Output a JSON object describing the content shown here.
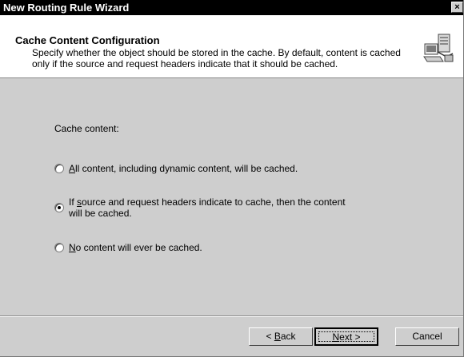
{
  "window": {
    "title": "New Routing Rule Wizard",
    "close_glyph": "×"
  },
  "header": {
    "title": "Cache Content Configuration",
    "description": "Specify whether the object should be stored in the cache. By default, content is cached only if the source and request headers indicate that it should be cached.",
    "icon": "wizard-computer-icon"
  },
  "content": {
    "prompt": "Cache content:",
    "options": [
      {
        "mnemonic": "A",
        "label_rest": "ll content, including dynamic content, will be cached.",
        "selected": false
      },
      {
        "label_pre": "If ",
        "mnemonic": "s",
        "label_rest": "ource and request headers indicate to cache, then the content\nwill be cached.",
        "selected": true
      },
      {
        "mnemonic": "N",
        "label_rest": "o content will ever be cached.",
        "selected": false
      }
    ]
  },
  "buttons": {
    "back": {
      "prefix": "< ",
      "mnemonic": "B",
      "rest": "ack"
    },
    "next": {
      "mnemonic": "N",
      "rest": "ext >"
    },
    "cancel": "Cancel"
  },
  "colors": {
    "titlebar": "#000000",
    "dialog_face": "#cecece",
    "header_bg": "#ffffff"
  }
}
